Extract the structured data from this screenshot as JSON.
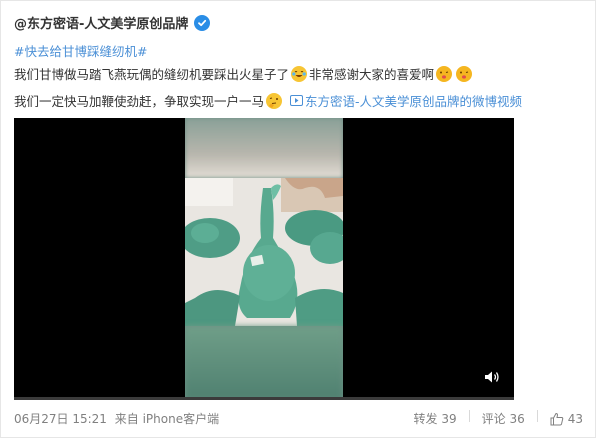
{
  "author": {
    "name": "@东方密语-人文美学原创品牌"
  },
  "topic": "#快去给甘博踩缝纫机#",
  "text": {
    "line1": "我们甘博做马踏飞燕玩偶的缝纫机要踩出火星子了",
    "line1b": "非常感谢大家的喜爱啊",
    "line2": "我们一定快马加鞭使劲赶，争取实现一户一马",
    "link": "东方密语-人文美学原创品牌的微博视频"
  },
  "footer": {
    "date": "06月27日 15:21",
    "source": "来自 iPhone客户端"
  },
  "actions": {
    "repost": "转发 39",
    "comment": "评论 36",
    "like": "43"
  },
  "icons": {
    "verified": "verified-badge-icon",
    "emoji1": "laugh-cry-emoji",
    "emoji2": "kiss-emoji",
    "emoji3": "thinking-emoji",
    "video_link": "video-link-icon",
    "volume": "volume-icon",
    "like": "thumbs-up-icon"
  },
  "colors": {
    "link": "#4a8fd6",
    "verified": "#2a8de6",
    "text": "#333333",
    "muted": "#808080"
  }
}
